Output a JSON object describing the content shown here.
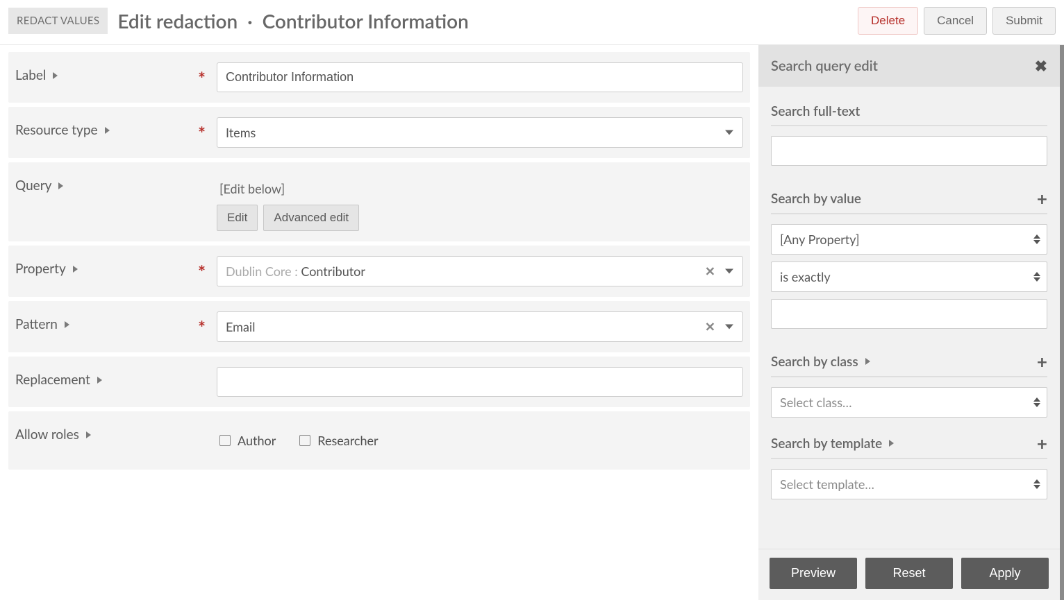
{
  "header": {
    "badge": "REDACT VALUES",
    "title": "Edit redaction  ·  Contributor Information",
    "delete": "Delete",
    "cancel": "Cancel",
    "submit": "Submit"
  },
  "form": {
    "label": {
      "label": "Label",
      "value": "Contributor Information"
    },
    "resource_type": {
      "label": "Resource type",
      "value": "Items"
    },
    "query": {
      "label": "Query",
      "hint": "[Edit below]",
      "edit": "Edit",
      "advanced": "Advanced edit"
    },
    "property": {
      "label": "Property",
      "vocab": "Dublin Core",
      "term": "Contributor"
    },
    "pattern": {
      "label": "Pattern",
      "value": "Email"
    },
    "replacement": {
      "label": "Replacement",
      "value": ""
    },
    "allow_roles": {
      "label": "Allow roles",
      "options": [
        "Author",
        "Researcher"
      ]
    }
  },
  "sidebar": {
    "title": "Search query edit",
    "fulltext_label": "Search full-text",
    "fulltext_value": "",
    "by_value": {
      "label": "Search by value",
      "property": "[Any Property]",
      "op": "is exactly",
      "value": ""
    },
    "by_class": {
      "label": "Search by class",
      "select": "Select class…"
    },
    "by_template": {
      "label": "Search by template",
      "select": "Select template…"
    },
    "buttons": {
      "preview": "Preview",
      "reset": "Reset",
      "apply": "Apply"
    }
  }
}
